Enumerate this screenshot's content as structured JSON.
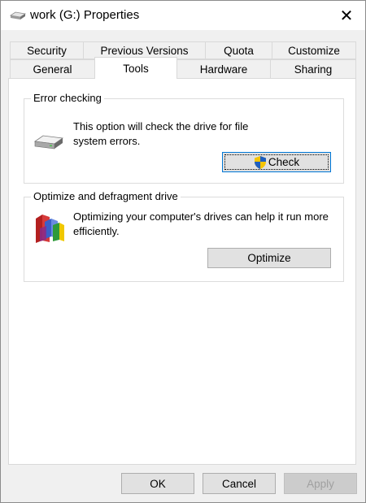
{
  "window": {
    "title": "work (G:) Properties",
    "close_glyph": "✕"
  },
  "tabs": {
    "row1": [
      "Security",
      "Previous Versions",
      "Quota",
      "Customize"
    ],
    "row2": [
      "General",
      "Tools",
      "Hardware",
      "Sharing"
    ],
    "active": "Tools"
  },
  "error_checking": {
    "group_label": "Error checking",
    "description": "This option will check the drive for file system errors.",
    "button_label": "Check",
    "button_icon": "uac-shield-icon"
  },
  "optimize": {
    "group_label": "Optimize and defragment drive",
    "description": "Optimizing your computer's drives can help it run more efficiently.",
    "button_label": "Optimize"
  },
  "footer": {
    "ok_label": "OK",
    "cancel_label": "Cancel",
    "apply_label": "Apply"
  },
  "colors": {
    "focus_border": "#0078d7",
    "panel_bg": "#ffffff",
    "dialog_bg": "#f0f0f0"
  }
}
